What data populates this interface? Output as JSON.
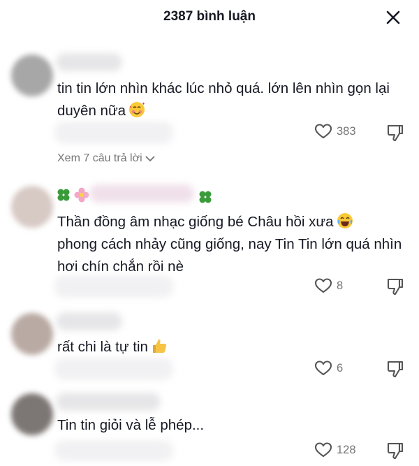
{
  "header": {
    "title": "2387 bình luận",
    "close_icon": "close-icon"
  },
  "comments": [
    {
      "text": "tin tin lớn nhìn khác lúc nhỏ quá. lớn lên nhìn gọn lại duyên nữa",
      "emoji": "smiling-face-with-hearts",
      "likes": "383",
      "replies_label": "Xem 7 câu trả lời"
    },
    {
      "text": "Thần đồng âm nhạc giống bé Châu hồi xưa",
      "text2": "phong cách nhảy cũng giống, nay Tin Tin lớn quá nhìn hơi chín chắn rồi nè",
      "emoji": "face-with-tears-of-joy",
      "likes": "8"
    },
    {
      "text": "rất chi là tự tin",
      "emoji": "thumbs-up",
      "likes": "6"
    },
    {
      "text": "Tin tin giỏi và lễ phép...",
      "likes": "128"
    }
  ],
  "colors": {
    "text": "#161823",
    "muted": "#757575",
    "accent_blur": "#e8e8ea"
  }
}
